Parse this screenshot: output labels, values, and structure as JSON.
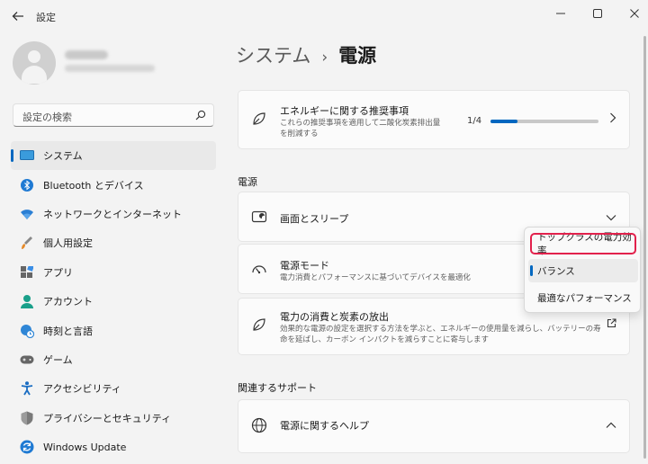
{
  "window": {
    "back_icon": "back-arrow-icon",
    "title": "設定",
    "minimize_icon": "minimize-icon",
    "maximize_icon": "maximize-icon",
    "close_icon": "close-icon"
  },
  "search": {
    "placeholder": "設定の検索",
    "icon": "search-icon"
  },
  "sidebar": {
    "items": [
      {
        "label": "システム",
        "icon": "monitor-icon",
        "selected": true
      },
      {
        "label": "Bluetooth とデバイス",
        "icon": "bluetooth-icon"
      },
      {
        "label": "ネットワークとインターネット",
        "icon": "wifi-icon"
      },
      {
        "label": "個人用設定",
        "icon": "brush-icon"
      },
      {
        "label": "アプリ",
        "icon": "apps-icon"
      },
      {
        "label": "アカウント",
        "icon": "person-icon"
      },
      {
        "label": "時刻と言語",
        "icon": "globe-clock-icon"
      },
      {
        "label": "ゲーム",
        "icon": "gamepad-icon"
      },
      {
        "label": "アクセシビリティ",
        "icon": "accessibility-icon"
      },
      {
        "label": "プライバシーとセキュリティ",
        "icon": "shield-icon"
      },
      {
        "label": "Windows Update",
        "icon": "update-icon"
      }
    ]
  },
  "breadcrumb": {
    "parent": "システム",
    "separator": "›",
    "current": "電源"
  },
  "recommendations": {
    "title": "エネルギーに関する推奨事項",
    "desc": [
      "これらの推奨事項を適用して二酸化炭素排出量",
      "を削減する"
    ],
    "progress_text": "1/4",
    "progress": 0.25,
    "icon": "leaf-icon"
  },
  "power_section": "電源",
  "screen_sleep": {
    "title": "画面とスリープ",
    "icon": "screen-sleep-icon"
  },
  "power_mode": {
    "title": "電源モード",
    "desc": "電力消費とパフォーマンスに基づいてデバイスを最適化",
    "icon": "gauge-icon"
  },
  "power_usage": {
    "title": "電力の消費と炭素の放出",
    "desc": [
      "効果的な電源の設定を選択する方法を学ぶと、エネルギーの使用量を減らし、バッテリーの寿",
      "命を延ばし、カーボン インパクトを減らすことに寄与します"
    ],
    "icon": "leaf-icon",
    "link_icon": "external-link-icon"
  },
  "dropdown": {
    "options": [
      {
        "label": "トップクラスの電力効率"
      },
      {
        "label": "バランス",
        "selected": true
      },
      {
        "label": "最適なパフォーマンス"
      }
    ],
    "highlight_color": "#e2214c"
  },
  "related_section": "関連するサポート",
  "power_help": {
    "title": "電源に関するヘルプ",
    "icon": "globe-icon"
  },
  "colors": {
    "accent": "#0067c0"
  }
}
